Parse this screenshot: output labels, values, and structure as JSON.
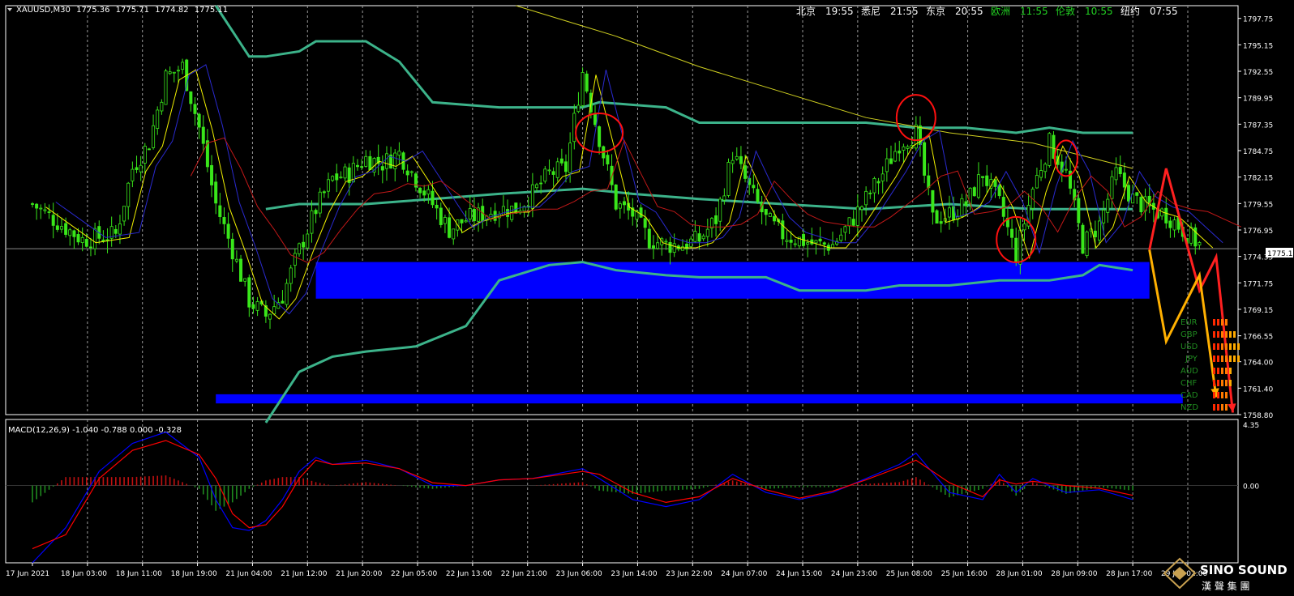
{
  "symbol_header": "XAUUSD,M30",
  "ohlc": [
    "1775.36",
    "1775.71",
    "1774.82",
    "1775.11"
  ],
  "clock": [
    {
      "city": "北京",
      "time": "19:55",
      "active": false
    },
    {
      "city": "悉尼",
      "time": "21:55",
      "active": false
    },
    {
      "city": "东京",
      "time": "20:55",
      "active": false
    },
    {
      "city": "欧洲",
      "time": "11:55",
      "active": true
    },
    {
      "city": "伦敦",
      "time": "10:55",
      "active": true
    },
    {
      "city": "纽约",
      "time": "07:55",
      "active": false
    }
  ],
  "current_price_label": "1775.11",
  "currency_strength": [
    "EUR",
    "GBP",
    "USD",
    "JPY",
    "AUD",
    "CHF",
    "CAD",
    "NZD"
  ],
  "logo": {
    "name": "SINO SOUND",
    "chinese": "漢 聲 集 團"
  },
  "colors": {
    "candle": "#39e61a",
    "bollinger": "#3cb38a",
    "slow_ma": "#cfcf20",
    "macd_main": "#0000ff",
    "macd_signal": "#ff0000",
    "support_zone": "#0000ff",
    "up_arrow": "#ff2020",
    "down_arrow": "#ffb000",
    "circle": "#ff1010"
  },
  "chart_data": [
    {
      "type": "candlestick",
      "title": "",
      "price_axis": [
        "1797.75",
        "1795.15",
        "1792.55",
        "1789.95",
        "1787.35",
        "1784.75",
        "1782.15",
        "1779.55",
        "1776.95",
        "1774.35",
        "1771.75",
        "1769.15",
        "1766.55",
        "1764.00",
        "1761.40",
        "1758.80"
      ],
      "ylim": [
        1758.8,
        1799.0
      ],
      "time_axis": [
        "17 Jun 2021",
        "18 Jun 03:00",
        "18 Jun 11:00",
        "18 Jun 19:00",
        "21 Jun 04:00",
        "21 Jun 12:00",
        "21 Jun 20:00",
        "22 Jun 05:00",
        "22 Jun 13:00",
        "22 Jun 21:00",
        "23 Jun 06:00",
        "23 Jun 14:00",
        "23 Jun 22:00",
        "24 Jun 07:00",
        "24 Jun 15:00",
        "24 Jun 23:00",
        "25 Jun 08:00",
        "25 Jun 16:00",
        "28 Jun 01:00",
        "28 Jun 09:00",
        "28 Jun 17:00",
        "29 Jun 02:00"
      ],
      "close_profile": [
        [
          0,
          1779.5
        ],
        [
          3,
          1776.0
        ],
        [
          5,
          1776.5
        ],
        [
          6,
          1783.0
        ],
        [
          7,
          1785.5
        ],
        [
          8,
          1792.0
        ],
        [
          9,
          1793.0
        ],
        [
          10,
          1787.0
        ],
        [
          11,
          1779.5
        ],
        [
          12,
          1775.0
        ],
        [
          13,
          1770.0
        ],
        [
          14,
          1768.5
        ],
        [
          15,
          1770.5
        ],
        [
          16,
          1775.0
        ],
        [
          17,
          1779.0
        ],
        [
          18,
          1782.0
        ],
        [
          19,
          1782.5
        ],
        [
          20,
          1784.0
        ],
        [
          21,
          1783.5
        ],
        [
          22,
          1784.5
        ],
        [
          23,
          1782.0
        ],
        [
          24,
          1779.5
        ],
        [
          25,
          1777.0
        ],
        [
          26,
          1778.0
        ],
        [
          27,
          1778.5
        ],
        [
          28,
          1779.0
        ],
        [
          29,
          1779.0
        ],
        [
          30,
          1780.5
        ],
        [
          31,
          1782.5
        ],
        [
          32,
          1783.0
        ],
        [
          33,
          1792.5
        ],
        [
          34,
          1786.0
        ],
        [
          35,
          1779.5
        ],
        [
          36,
          1778.5
        ],
        [
          37,
          1776.0
        ],
        [
          38,
          1775.5
        ],
        [
          39,
          1775.5
        ],
        [
          40,
          1776.0
        ],
        [
          41,
          1778.0
        ],
        [
          42,
          1784.5
        ],
        [
          43,
          1781.0
        ],
        [
          44,
          1778.0
        ],
        [
          45,
          1776.5
        ],
        [
          46,
          1776.0
        ],
        [
          47,
          1775.5
        ],
        [
          48,
          1775.5
        ],
        [
          49,
          1777.5
        ],
        [
          50,
          1780.0
        ],
        [
          51,
          1782.5
        ],
        [
          52,
          1785.5
        ],
        [
          53,
          1786.5
        ],
        [
          54,
          1778.0
        ],
        [
          55,
          1778.5
        ],
        [
          56,
          1779.5
        ],
        [
          57,
          1782.5
        ],
        [
          58,
          1779.5
        ],
        [
          59,
          1774.5
        ],
        [
          60,
          1781.0
        ],
        [
          61,
          1785.5
        ],
        [
          62,
          1782.5
        ],
        [
          63,
          1775.5
        ],
        [
          64,
          1777.5
        ],
        [
          65,
          1782.5
        ],
        [
          66,
          1780.0
        ],
        [
          67,
          1779.0
        ],
        [
          68,
          1778.5
        ],
        [
          69,
          1777.0
        ],
        [
          70,
          1775.5
        ]
      ],
      "bollinger": {
        "upper": [
          [
            11,
            1799.0
          ],
          [
            13,
            1794.0
          ],
          [
            14,
            1794.0
          ],
          [
            16,
            1794.5
          ],
          [
            17,
            1795.5
          ],
          [
            20,
            1795.5
          ],
          [
            22,
            1793.5
          ],
          [
            24,
            1789.5
          ],
          [
            28,
            1789.0
          ],
          [
            33,
            1789.0
          ],
          [
            34,
            1789.5
          ],
          [
            38,
            1789.0
          ],
          [
            40,
            1787.5
          ],
          [
            45,
            1787.5
          ],
          [
            50,
            1787.5
          ],
          [
            53,
            1787.0
          ],
          [
            56,
            1787.0
          ],
          [
            59,
            1786.5
          ],
          [
            61,
            1787.0
          ],
          [
            63,
            1786.5
          ],
          [
            65,
            1786.5
          ],
          [
            66,
            1786.5
          ]
        ],
        "middle": [
          [
            14,
            1779.0
          ],
          [
            16,
            1779.5
          ],
          [
            20,
            1779.5
          ],
          [
            24,
            1780.0
          ],
          [
            28,
            1780.5
          ],
          [
            33,
            1781.0
          ],
          [
            36,
            1780.5
          ],
          [
            40,
            1780.0
          ],
          [
            45,
            1779.5
          ],
          [
            50,
            1779.0
          ],
          [
            55,
            1779.5
          ],
          [
            60,
            1779.0
          ],
          [
            63,
            1779.0
          ],
          [
            66,
            1779.0
          ]
        ],
        "lower": [
          [
            14,
            1758.0
          ],
          [
            16,
            1763.0
          ],
          [
            18,
            1764.5
          ],
          [
            20,
            1765.0
          ],
          [
            23,
            1765.5
          ],
          [
            26,
            1767.5
          ],
          [
            28,
            1772.0
          ],
          [
            31,
            1773.5
          ],
          [
            33,
            1773.8
          ],
          [
            35,
            1773.0
          ],
          [
            38,
            1772.5
          ],
          [
            40,
            1772.3
          ],
          [
            44,
            1772.3
          ],
          [
            46,
            1771.0
          ],
          [
            50,
            1771.0
          ],
          [
            52,
            1771.5
          ],
          [
            55,
            1771.5
          ],
          [
            58,
            1772.0
          ],
          [
            61,
            1772.0
          ],
          [
            63,
            1772.5
          ],
          [
            64,
            1773.5
          ],
          [
            66,
            1773.0
          ]
        ]
      },
      "slow_ma": [
        [
          29,
          1799.0
        ],
        [
          33,
          1797.0
        ],
        [
          35,
          1796.0
        ],
        [
          40,
          1793.0
        ],
        [
          45,
          1790.5
        ],
        [
          50,
          1788.0
        ],
        [
          55,
          1786.5
        ],
        [
          60,
          1785.5
        ],
        [
          66,
          1783.0
        ]
      ],
      "support_zones": [
        {
          "top": 1773.8,
          "bottom": 1770.2,
          "from": 17,
          "to": 67
        },
        {
          "top": 1760.8,
          "bottom": 1759.9,
          "from": 11,
          "to": 69
        }
      ],
      "highlight_circles": [
        34,
        53,
        59,
        62
      ],
      "scenario_path_up": [
        [
          67,
          1775.0
        ],
        [
          68,
          1783.0
        ],
        [
          70,
          1771.0
        ],
        [
          71,
          1774.3
        ],
        [
          72,
          1759.0
        ]
      ],
      "scenario_path_down": [
        [
          67,
          1775.0
        ],
        [
          68,
          1766.0
        ],
        [
          70,
          1772.5
        ],
        [
          71,
          1760.5
        ]
      ]
    },
    {
      "type": "line",
      "title": "MACD(12,26,9) -1.040 -0.788 0.000 -0.328",
      "ticks": [
        "4.35",
        "0.00"
      ],
      "ylim": [
        -5.5,
        4.7
      ],
      "main": [
        [
          0,
          -5.5
        ],
        [
          2,
          -3.0
        ],
        [
          4,
          1.0
        ],
        [
          6,
          3.0
        ],
        [
          8,
          3.8
        ],
        [
          10,
          2.0
        ],
        [
          11,
          -1.0
        ],
        [
          12,
          -3.0
        ],
        [
          13,
          -3.2
        ],
        [
          14,
          -2.5
        ],
        [
          15,
          -1.0
        ],
        [
          16,
          1.0
        ],
        [
          17,
          2.0
        ],
        [
          18,
          1.5
        ],
        [
          20,
          1.8
        ],
        [
          22,
          1.2
        ],
        [
          24,
          0.0
        ],
        [
          26,
          0.0
        ],
        [
          28,
          0.4
        ],
        [
          30,
          0.5
        ],
        [
          33,
          1.2
        ],
        [
          34,
          0.5
        ],
        [
          36,
          -1.0
        ],
        [
          38,
          -1.5
        ],
        [
          40,
          -1.0
        ],
        [
          42,
          0.8
        ],
        [
          44,
          -0.5
        ],
        [
          46,
          -1.0
        ],
        [
          48,
          -0.5
        ],
        [
          50,
          0.5
        ],
        [
          52,
          1.5
        ],
        [
          53,
          2.3
        ],
        [
          55,
          -0.5
        ],
        [
          57,
          -1.0
        ],
        [
          58,
          0.8
        ],
        [
          59,
          -0.5
        ],
        [
          60,
          0.5
        ],
        [
          62,
          -0.5
        ],
        [
          64,
          -0.3
        ],
        [
          66,
          -1.0
        ]
      ],
      "signal": [
        [
          0,
          -4.5
        ],
        [
          2,
          -3.5
        ],
        [
          4,
          0.5
        ],
        [
          6,
          2.5
        ],
        [
          8,
          3.2
        ],
        [
          10,
          2.2
        ],
        [
          11,
          0.5
        ],
        [
          12,
          -2.0
        ],
        [
          13,
          -3.0
        ],
        [
          14,
          -2.8
        ],
        [
          15,
          -1.5
        ],
        [
          16,
          0.5
        ],
        [
          17,
          1.8
        ],
        [
          18,
          1.5
        ],
        [
          20,
          1.6
        ],
        [
          22,
          1.2
        ],
        [
          24,
          0.2
        ],
        [
          26,
          0.0
        ],
        [
          28,
          0.4
        ],
        [
          30,
          0.5
        ],
        [
          33,
          1.0
        ],
        [
          34,
          0.8
        ],
        [
          36,
          -0.5
        ],
        [
          38,
          -1.2
        ],
        [
          40,
          -0.8
        ],
        [
          42,
          0.5
        ],
        [
          44,
          -0.3
        ],
        [
          46,
          -0.9
        ],
        [
          48,
          -0.4
        ],
        [
          50,
          0.4
        ],
        [
          52,
          1.3
        ],
        [
          53,
          1.8
        ],
        [
          55,
          0.2
        ],
        [
          57,
          -0.8
        ],
        [
          58,
          0.4
        ],
        [
          59,
          0.1
        ],
        [
          60,
          0.3
        ],
        [
          62,
          0.0
        ],
        [
          64,
          -0.2
        ],
        [
          66,
          -0.7
        ]
      ]
    }
  ]
}
